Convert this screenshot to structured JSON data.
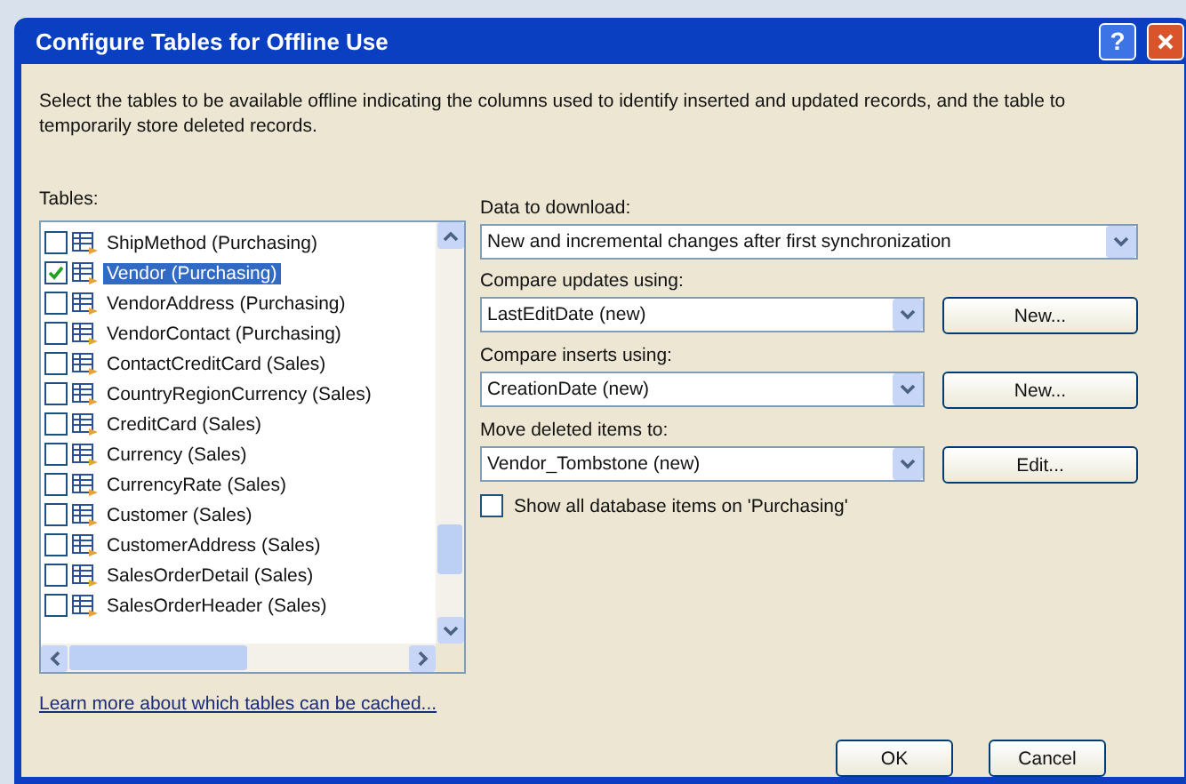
{
  "window": {
    "title": "Configure Tables for Offline Use",
    "help_button": "?"
  },
  "intro": "Select the tables to be available offline indicating the columns used to identify inserted and updated records, and the table to temporarily store deleted records.",
  "tables": {
    "label": "Tables:",
    "items": [
      {
        "name": "ShipMethod (Purchasing)",
        "checked": false,
        "selected": false
      },
      {
        "name": "Vendor (Purchasing)",
        "checked": true,
        "selected": true
      },
      {
        "name": "VendorAddress (Purchasing)",
        "checked": false,
        "selected": false
      },
      {
        "name": "VendorContact (Purchasing)",
        "checked": false,
        "selected": false
      },
      {
        "name": "ContactCreditCard (Sales)",
        "checked": false,
        "selected": false
      },
      {
        "name": "CountryRegionCurrency (Sales)",
        "checked": false,
        "selected": false
      },
      {
        "name": "CreditCard (Sales)",
        "checked": false,
        "selected": false
      },
      {
        "name": "Currency (Sales)",
        "checked": false,
        "selected": false
      },
      {
        "name": "CurrencyRate (Sales)",
        "checked": false,
        "selected": false
      },
      {
        "name": "Customer (Sales)",
        "checked": false,
        "selected": false
      },
      {
        "name": "CustomerAddress (Sales)",
        "checked": false,
        "selected": false
      },
      {
        "name": "SalesOrderDetail (Sales)",
        "checked": false,
        "selected": false
      },
      {
        "name": "SalesOrderHeader (Sales)",
        "checked": false,
        "selected": false
      }
    ]
  },
  "link": "Learn more about which tables can be cached...",
  "settings": [
    {
      "label": "Data to download:",
      "value": "New and incremental changes after first synchronization"
    },
    {
      "label": "Compare updates using:",
      "value": "LastEditDate (new)",
      "button": "New..."
    },
    {
      "label": "Compare inserts using:",
      "value": "CreationDate (new)",
      "button": "New..."
    },
    {
      "label": "Move deleted items to:",
      "value": "Vendor_Tombstone (new)",
      "button": "Edit..."
    }
  ],
  "show_all": {
    "label": "Show all database items on 'Purchasing'",
    "checked": false
  },
  "buttons": [
    "OK",
    "Cancel"
  ]
}
